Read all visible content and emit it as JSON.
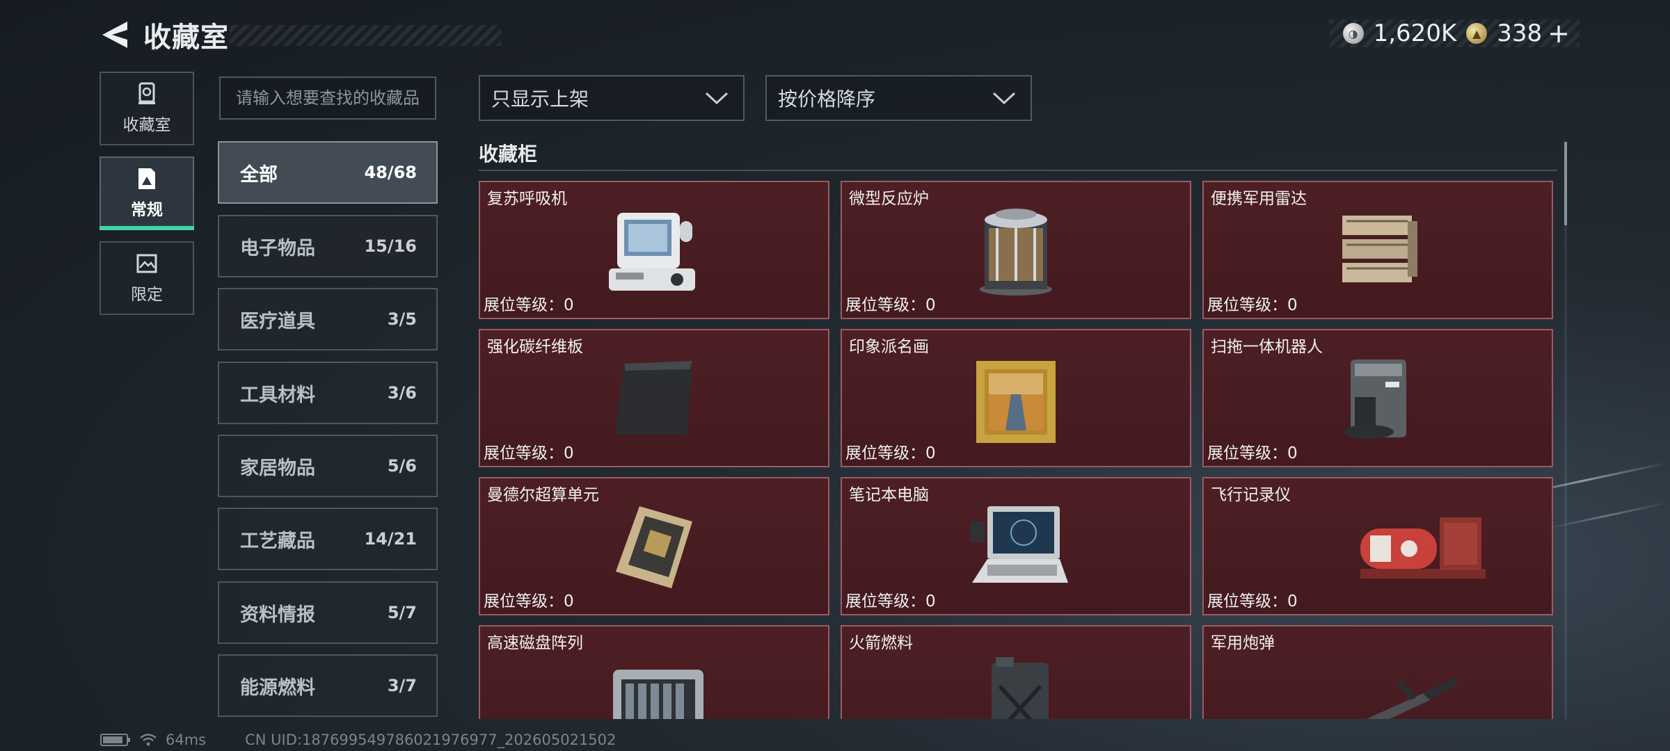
{
  "header": {
    "title": "收藏室"
  },
  "currency": {
    "silver": "1,620K",
    "gold": "338",
    "plus": "+"
  },
  "nav": [
    {
      "label": "收藏室",
      "icon": "trophy-icon"
    },
    {
      "label": "常规",
      "icon": "document-icon",
      "active": true
    },
    {
      "label": "限定",
      "icon": "image-icon"
    }
  ],
  "search": {
    "placeholder": "请输入想要查找的收藏品"
  },
  "categories": [
    {
      "name": "全部",
      "count": "48/68",
      "active": true
    },
    {
      "name": "电子物品",
      "count": "15/16"
    },
    {
      "name": "医疗道具",
      "count": "3/5"
    },
    {
      "name": "工具材料",
      "count": "3/6"
    },
    {
      "name": "家居物品",
      "count": "5/6"
    },
    {
      "name": "工艺藏品",
      "count": "14/21"
    },
    {
      "name": "资料情报",
      "count": "5/7"
    },
    {
      "name": "能源燃料",
      "count": "3/7"
    }
  ],
  "filters": {
    "shelf": "只显示上架",
    "sort": "按价格降序"
  },
  "section": {
    "title": "收藏柜"
  },
  "items": [
    {
      "name": "复苏呼吸机",
      "level": "展位等级：0",
      "icon": "ventilator-icon"
    },
    {
      "name": "微型反应炉",
      "level": "展位等级：0",
      "icon": "reactor-icon"
    },
    {
      "name": "便携军用雷达",
      "level": "展位等级：0",
      "icon": "radar-icon"
    },
    {
      "name": "强化碳纤维板",
      "level": "展位等级：0",
      "icon": "carbon-plate-icon"
    },
    {
      "name": "印象派名画",
      "level": "展位等级：0",
      "icon": "painting-icon"
    },
    {
      "name": "扫拖一体机器人",
      "level": "展位等级：0",
      "icon": "robot-vacuum-icon"
    },
    {
      "name": "曼德尔超算单元",
      "level": "展位等级：0",
      "icon": "supercomputer-icon"
    },
    {
      "name": "笔记本电脑",
      "level": "展位等级：0",
      "icon": "laptop-icon"
    },
    {
      "name": "飞行记录仪",
      "level": "展位等级：0",
      "icon": "flight-recorder-icon"
    },
    {
      "name": "高速磁盘阵列",
      "level": "",
      "icon": "disk-array-icon"
    },
    {
      "name": "火箭燃料",
      "level": "",
      "icon": "fuel-can-icon"
    },
    {
      "name": "军用炮弹",
      "level": "",
      "icon": "shell-icon"
    }
  ],
  "footer": {
    "ping": "64ms",
    "uid": "CN UID:1876995497860219769​77_202605021502"
  },
  "colors": {
    "accent": "#3fd6a4",
    "card_bg": "#4d1f24",
    "card_border": "#9a5b62"
  }
}
